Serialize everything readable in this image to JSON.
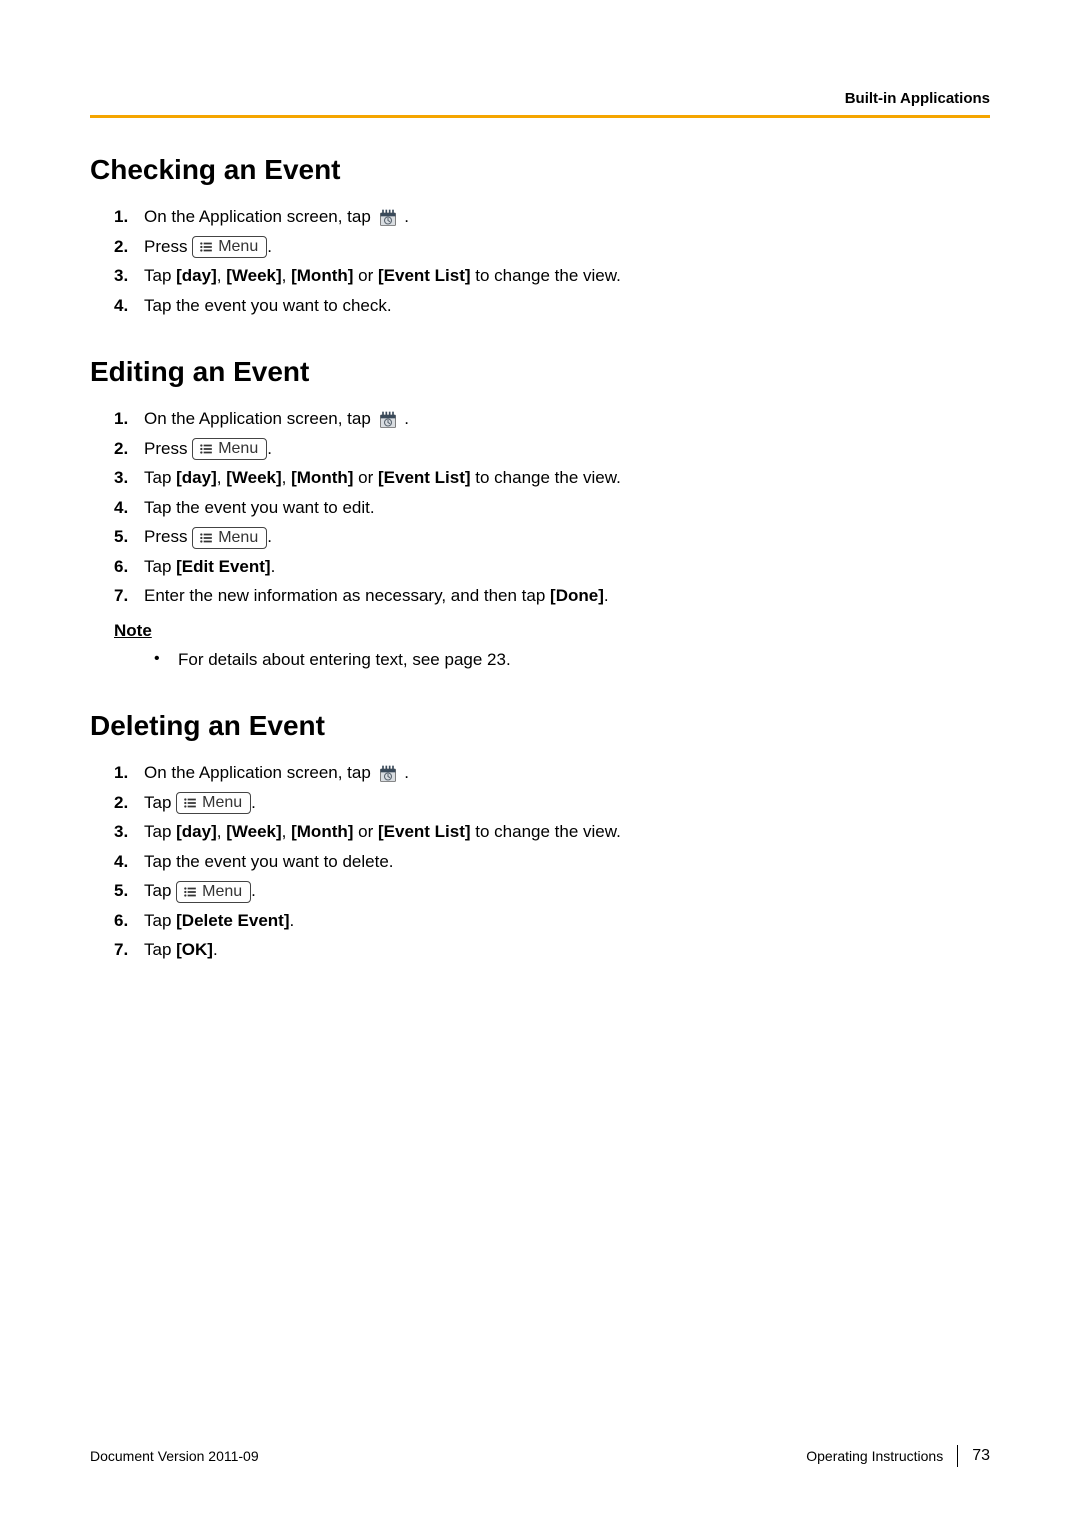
{
  "header": {
    "section": "Built-in Applications"
  },
  "menu_label": "Menu",
  "sections": [
    {
      "title": "Checking an Event",
      "steps": [
        {
          "pre": "On the Application screen, tap ",
          "icon": "calendar",
          "post": " ."
        },
        {
          "pre": "Press ",
          "menu": true,
          "post": "."
        },
        {
          "parts": [
            "Tap ",
            "[day]",
            ", ",
            "[Week]",
            ", ",
            "[Month]",
            " or ",
            "[Event List]",
            " to change the view."
          ]
        },
        {
          "text": "Tap the event you want to check."
        }
      ]
    },
    {
      "title": "Editing an Event",
      "steps": [
        {
          "pre": "On the Application screen, tap ",
          "icon": "calendar",
          "post": " ."
        },
        {
          "pre": "Press ",
          "menu": true,
          "post": "."
        },
        {
          "parts": [
            "Tap ",
            "[day]",
            ", ",
            "[Week]",
            ", ",
            "[Month]",
            " or ",
            "[Event List]",
            " to change the view."
          ]
        },
        {
          "text": "Tap the event you want to edit."
        },
        {
          "pre": "Press ",
          "menu": true,
          "post": "."
        },
        {
          "parts": [
            "Tap ",
            "[Edit Event]",
            "."
          ]
        },
        {
          "parts": [
            "Enter the new information as necessary, and then tap ",
            "[Done]",
            "."
          ]
        }
      ],
      "note": {
        "heading": "Note",
        "items": [
          "For details about entering text, see page 23."
        ]
      }
    },
    {
      "title": "Deleting an Event",
      "steps": [
        {
          "pre": "On the Application screen, tap ",
          "icon": "calendar",
          "post": " ."
        },
        {
          "pre": "Tap ",
          "menu": true,
          "post": "."
        },
        {
          "parts": [
            "Tap ",
            "[day]",
            ", ",
            "[Week]",
            ", ",
            "[Month]",
            " or ",
            "[Event List]",
            " to change the view."
          ]
        },
        {
          "text": "Tap the event you want to delete."
        },
        {
          "pre": "Tap ",
          "menu": true,
          "post": "."
        },
        {
          "parts": [
            "Tap ",
            "[Delete Event]",
            "."
          ]
        },
        {
          "parts": [
            "Tap ",
            "[OK]",
            "."
          ]
        }
      ]
    }
  ],
  "footer": {
    "left": "Document Version  2011-09",
    "right_label": "Operating Instructions",
    "page": "73"
  }
}
